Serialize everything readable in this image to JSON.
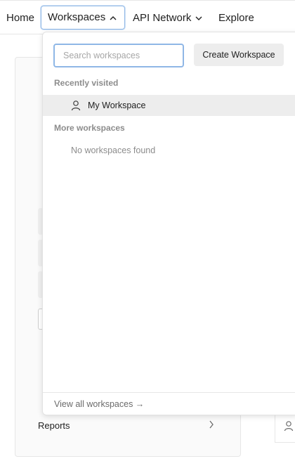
{
  "nav": {
    "home": "Home",
    "workspaces": "Workspaces",
    "api_network": "API Network",
    "explore": "Explore"
  },
  "dropdown": {
    "search_placeholder": "Search workspaces",
    "search_value": "",
    "create_button": "Create Workspace",
    "recent_label": "Recently visited",
    "recent_items": [
      {
        "label": "My Workspace",
        "icon": "person-icon"
      }
    ],
    "more_label": "More workspaces",
    "empty_message": "No workspaces found",
    "view_all": "View all workspaces →"
  },
  "background": {
    "reports": "Reports"
  },
  "colors": {
    "focus_border": "#8fb7e6",
    "highlight_row": "#ededed",
    "muted_text": "#8c8c8c"
  }
}
